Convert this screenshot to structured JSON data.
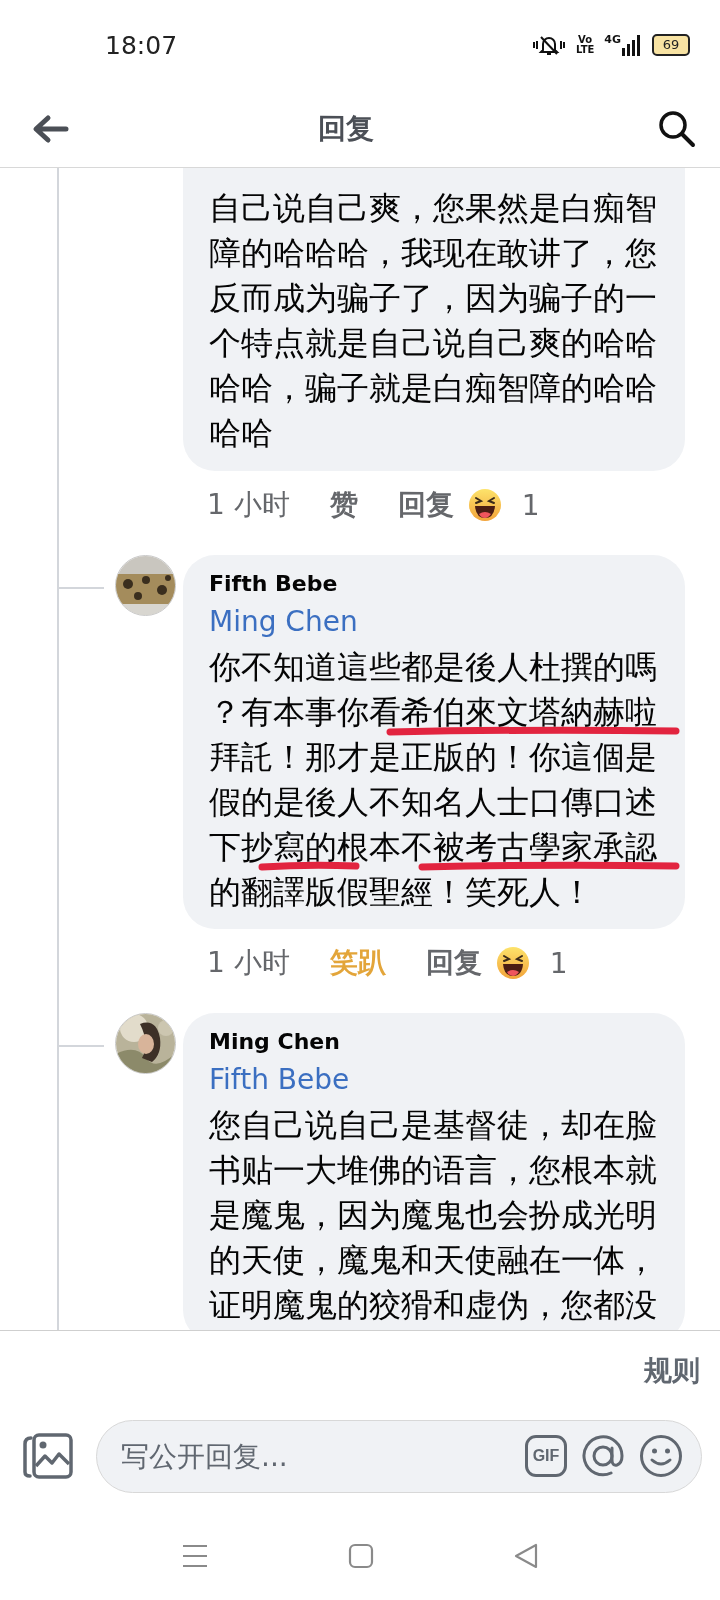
{
  "status_bar": {
    "time": "18:07",
    "volte_top": "Vo",
    "volte_bottom": "LTE",
    "network": "4G",
    "battery": "69"
  },
  "header": {
    "title": "回复"
  },
  "comments": [
    {
      "body_lines": [
        [
          {
            "text": "自己说自己爽，您果然是白痴智"
          }
        ],
        [
          {
            "text": "障的哈哈哈，我现在敢讲了，您"
          }
        ],
        [
          {
            "text": "反而成为骗子了，因为骗子的一"
          }
        ],
        [
          {
            "text": "个特点就是自己说自己爽的哈哈"
          }
        ],
        [
          {
            "text": "哈哈，骗子就是白痴智障的哈哈"
          }
        ],
        [
          {
            "text": "哈哈"
          }
        ]
      ],
      "time": "1 小时",
      "like": {
        "label": "赞",
        "reacted": false
      },
      "reply": "回复",
      "reaction_count": "1"
    },
    {
      "author": "Fifth Bebe",
      "mention": "Ming Chen",
      "avatar": {
        "kind": "picture"
      },
      "body_lines": [
        [
          {
            "text": "你不知道這些都是後人杜撰的嗎"
          }
        ],
        [
          {
            "text": "？有本事你看"
          },
          {
            "text": "希伯來文塔納赫啦",
            "marked": true
          }
        ],
        [
          {
            "text": "拜託！那才是正版的！你這個是"
          }
        ],
        [
          {
            "text": "假的是後人不知名人士口傳口述"
          }
        ],
        [
          {
            "text": "下抄"
          },
          {
            "text": "寫的",
            "marked": true
          },
          {
            "text": "根本不"
          },
          {
            "text": "被考古學家承認",
            "marked": true
          }
        ],
        [
          {
            "text": "的翻譯版假聖經！笑死人！"
          }
        ]
      ],
      "time": "1 小时",
      "like": {
        "label": "笑趴",
        "reacted": true
      },
      "reply": "回复",
      "reaction_count": "1"
    },
    {
      "author": "Ming Chen",
      "mention": "Fifth Bebe",
      "avatar": {
        "kind": "picture"
      },
      "body_lines": [
        [
          {
            "text": "您自己说自己是基督徒，却在脸"
          }
        ],
        [
          {
            "text": "书贴一大堆佛的语言，您根本就"
          }
        ],
        [
          {
            "text": "是魔鬼，因为魔鬼也会扮成光明"
          }
        ],
        [
          {
            "text": "的天使，魔鬼和天使融在一体，"
          }
        ],
        [
          {
            "text": "证明魔鬼的狡猾和虚伪，您都没"
          }
        ]
      ]
    }
  ],
  "rules_link": "规则",
  "composer": {
    "placeholder": "写公开回复...",
    "gif_label": "GIF"
  }
}
